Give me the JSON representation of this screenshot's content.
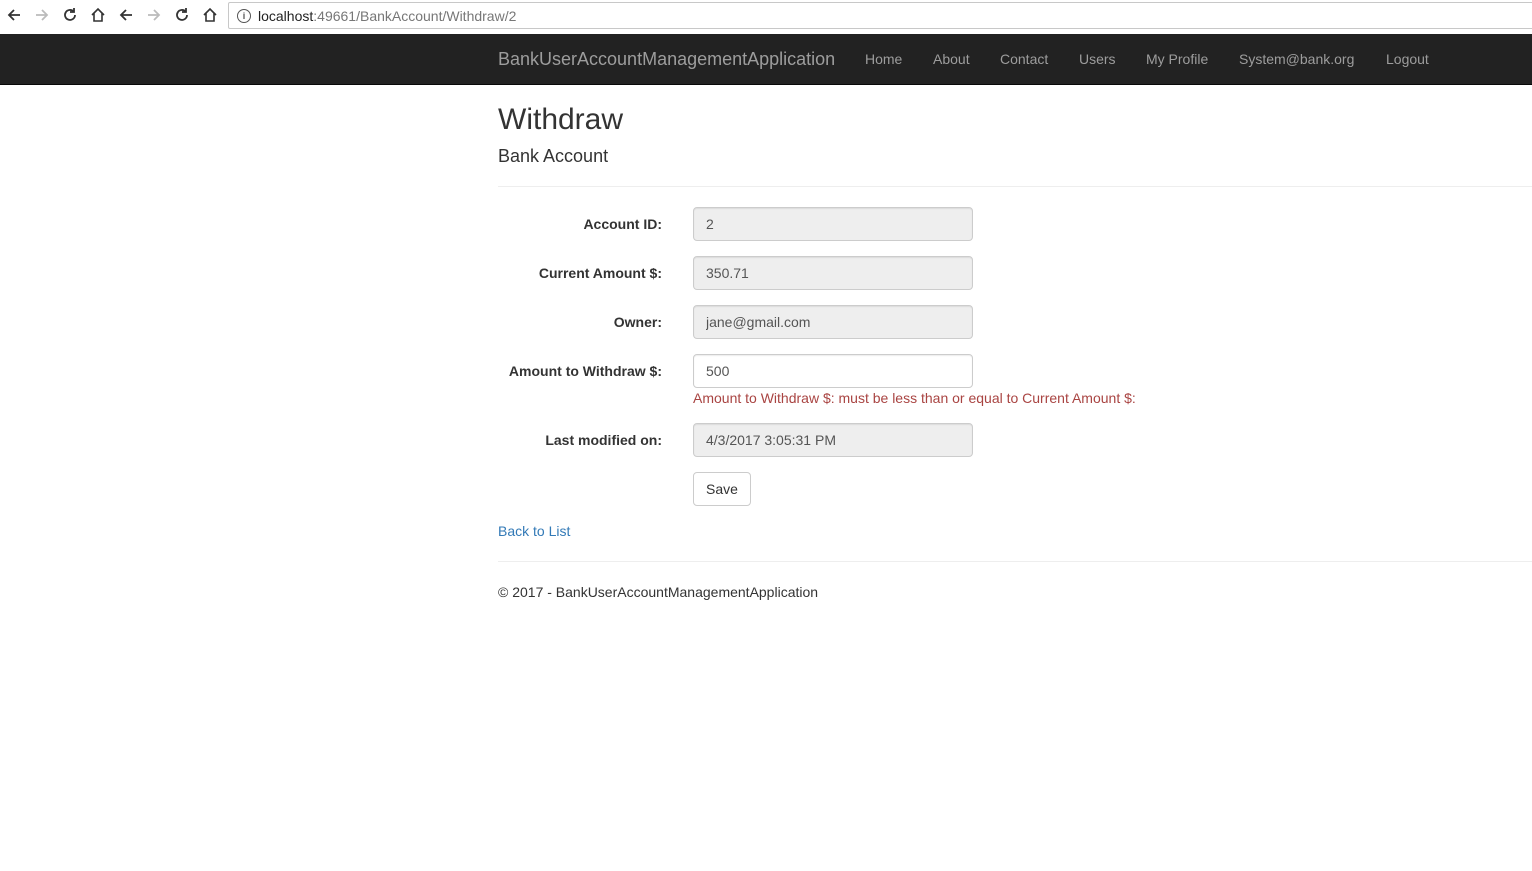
{
  "browser": {
    "url_host": "localhost",
    "url_rest": ":49661/BankAccount/Withdraw/2"
  },
  "navbar": {
    "brand": "BankUserAccountManagementApplication",
    "links": [
      "Home",
      "About",
      "Contact",
      "Users",
      "My Profile",
      "System@bank.org",
      "Logout"
    ]
  },
  "page": {
    "title": "Withdraw",
    "subtitle": "Bank Account"
  },
  "form": {
    "account_id_label": "Account ID:",
    "account_id_value": "2",
    "current_amount_label": "Current Amount $:",
    "current_amount_value": "350.71",
    "owner_label": "Owner:",
    "owner_value": "jane@gmail.com",
    "withdraw_label": "Amount to Withdraw $:",
    "withdraw_value": "500",
    "withdraw_error": "Amount to Withdraw $: must be less than or equal to Current Amount $:",
    "modified_label": "Last modified on:",
    "modified_value": "4/3/2017 3:05:31 PM",
    "save_label": "Save"
  },
  "back_link": "Back to List",
  "footer": "© 2017 - BankUserAccountManagementApplication",
  "colors": {
    "navbar_bg": "#222222",
    "nav_text": "#9d9d9d",
    "link": "#337ab7",
    "error": "#a94442"
  }
}
